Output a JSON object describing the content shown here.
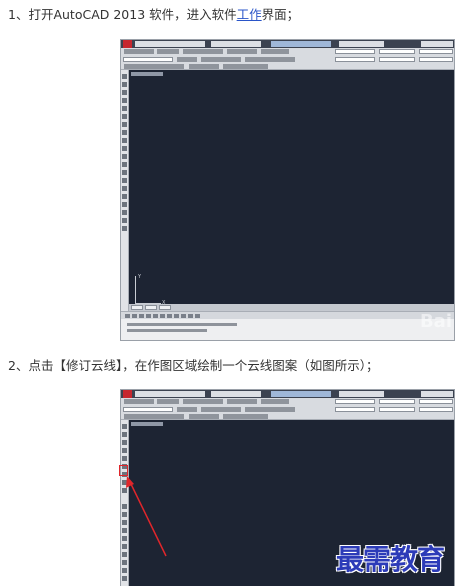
{
  "steps": [
    {
      "prefix": "1、打开AutoCAD 2013 软件，进入软件",
      "link_text": "工作",
      "suffix": "界面；"
    },
    {
      "text": "2、点击【修订云线】，在作图区域绘制一个云线图案（如图所示）；"
    }
  ],
  "screenshot_watermark": "Bai",
  "watermark": "最需教育",
  "colors": {
    "canvas": "#1d2433",
    "highlight": "#e0262b",
    "link": "#2a55c8",
    "watermark": "#2c3bb8"
  },
  "icons": [
    "autocad-app-icon",
    "red-arrow-icon",
    "ucs-axis-icon"
  ]
}
